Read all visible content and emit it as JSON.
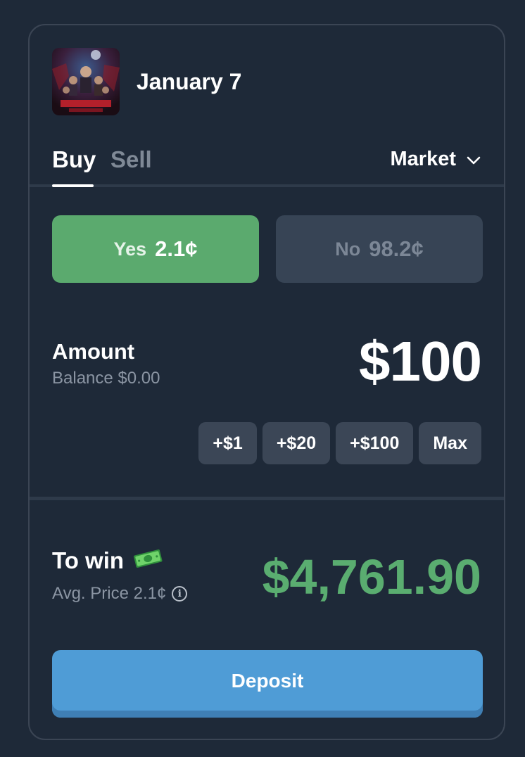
{
  "market": {
    "title": "January 7",
    "thumbnail_icon": "show-poster-thumbnail"
  },
  "tabs": {
    "buy": "Buy",
    "sell": "Sell",
    "active": "buy"
  },
  "order_type": {
    "selected": "Market",
    "icon": "chevron-down-icon"
  },
  "outcomes": {
    "yes": {
      "label": "Yes",
      "price": "2.1¢",
      "selected": true
    },
    "no": {
      "label": "No",
      "price": "98.2¢",
      "selected": false
    }
  },
  "amount": {
    "label": "Amount",
    "balance": "Balance $0.00",
    "value": "$100"
  },
  "quick_add": [
    "+$1",
    "+$20",
    "+$100",
    "Max"
  ],
  "to_win": {
    "label": "To win",
    "icon": "money-bill-icon",
    "avg_price": "Avg. Price 2.1¢",
    "value": "$4,761.90"
  },
  "deposit_label": "Deposit",
  "colors": {
    "yes_green": "#5baa6e",
    "win_green": "#5aad70",
    "deposit_blue": "#4f9cd6",
    "background": "#1e2938"
  }
}
